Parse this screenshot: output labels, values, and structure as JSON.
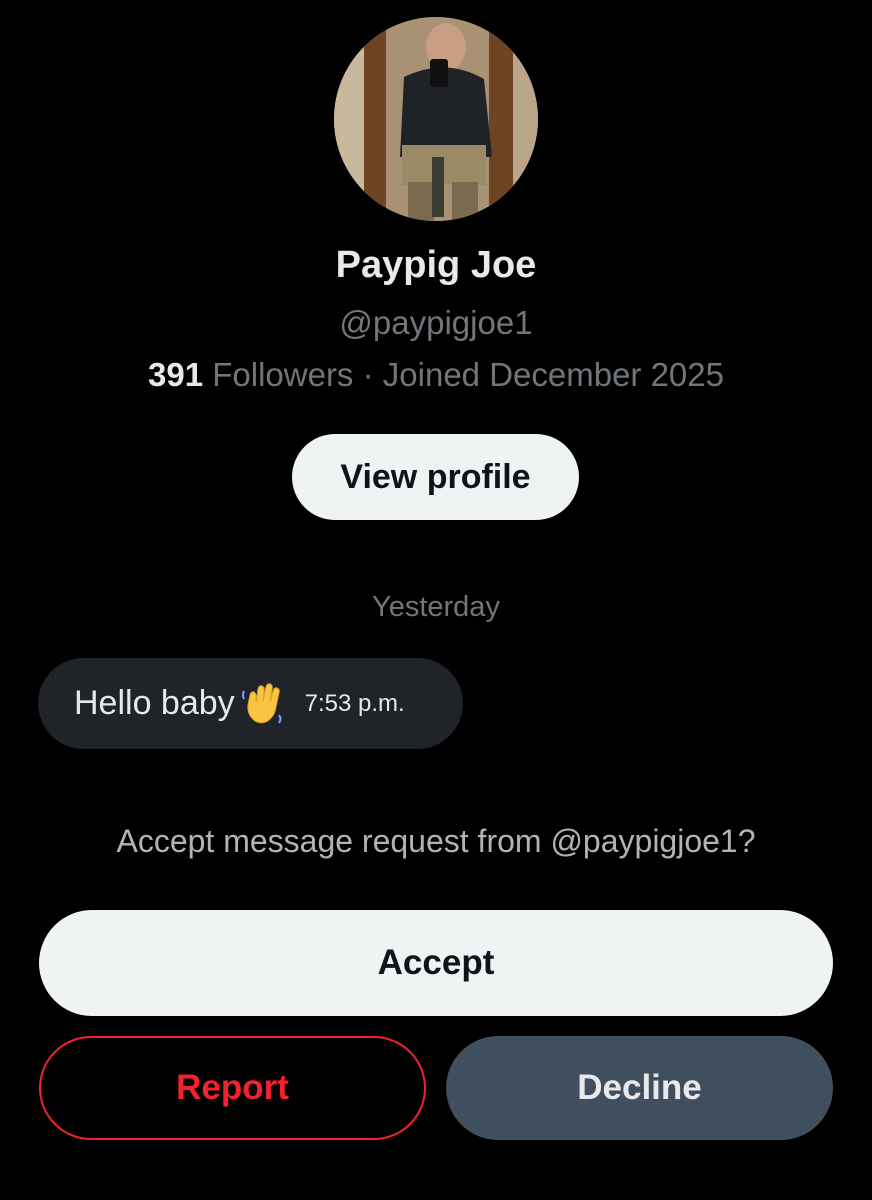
{
  "profile": {
    "display_name": "Paypig Joe",
    "handle": "@paypigjoe1",
    "followers_count": "391",
    "followers_label": "Followers",
    "separator": "·",
    "joined_text": "Joined December 2025",
    "avatar_icon": "profile-photo-mirror-selfie"
  },
  "view_profile_label": "View profile",
  "conversation": {
    "date_divider": "Yesterday",
    "messages": [
      {
        "text": "Hello baby",
        "emoji_icon": "waving-hand-icon",
        "time": "7:53 p.m."
      }
    ]
  },
  "request": {
    "prompt": "Accept message request from @paypigjoe1?",
    "accept_label": "Accept",
    "report_label": "Report",
    "decline_label": "Decline"
  },
  "colors": {
    "background": "#000000",
    "primary_text": "#e7e9ea",
    "secondary_text": "#71767b",
    "light_button": "#eff3f4",
    "bubble": "#202327",
    "report_red": "#f4212e",
    "decline_gray": "#3f4f5e"
  }
}
